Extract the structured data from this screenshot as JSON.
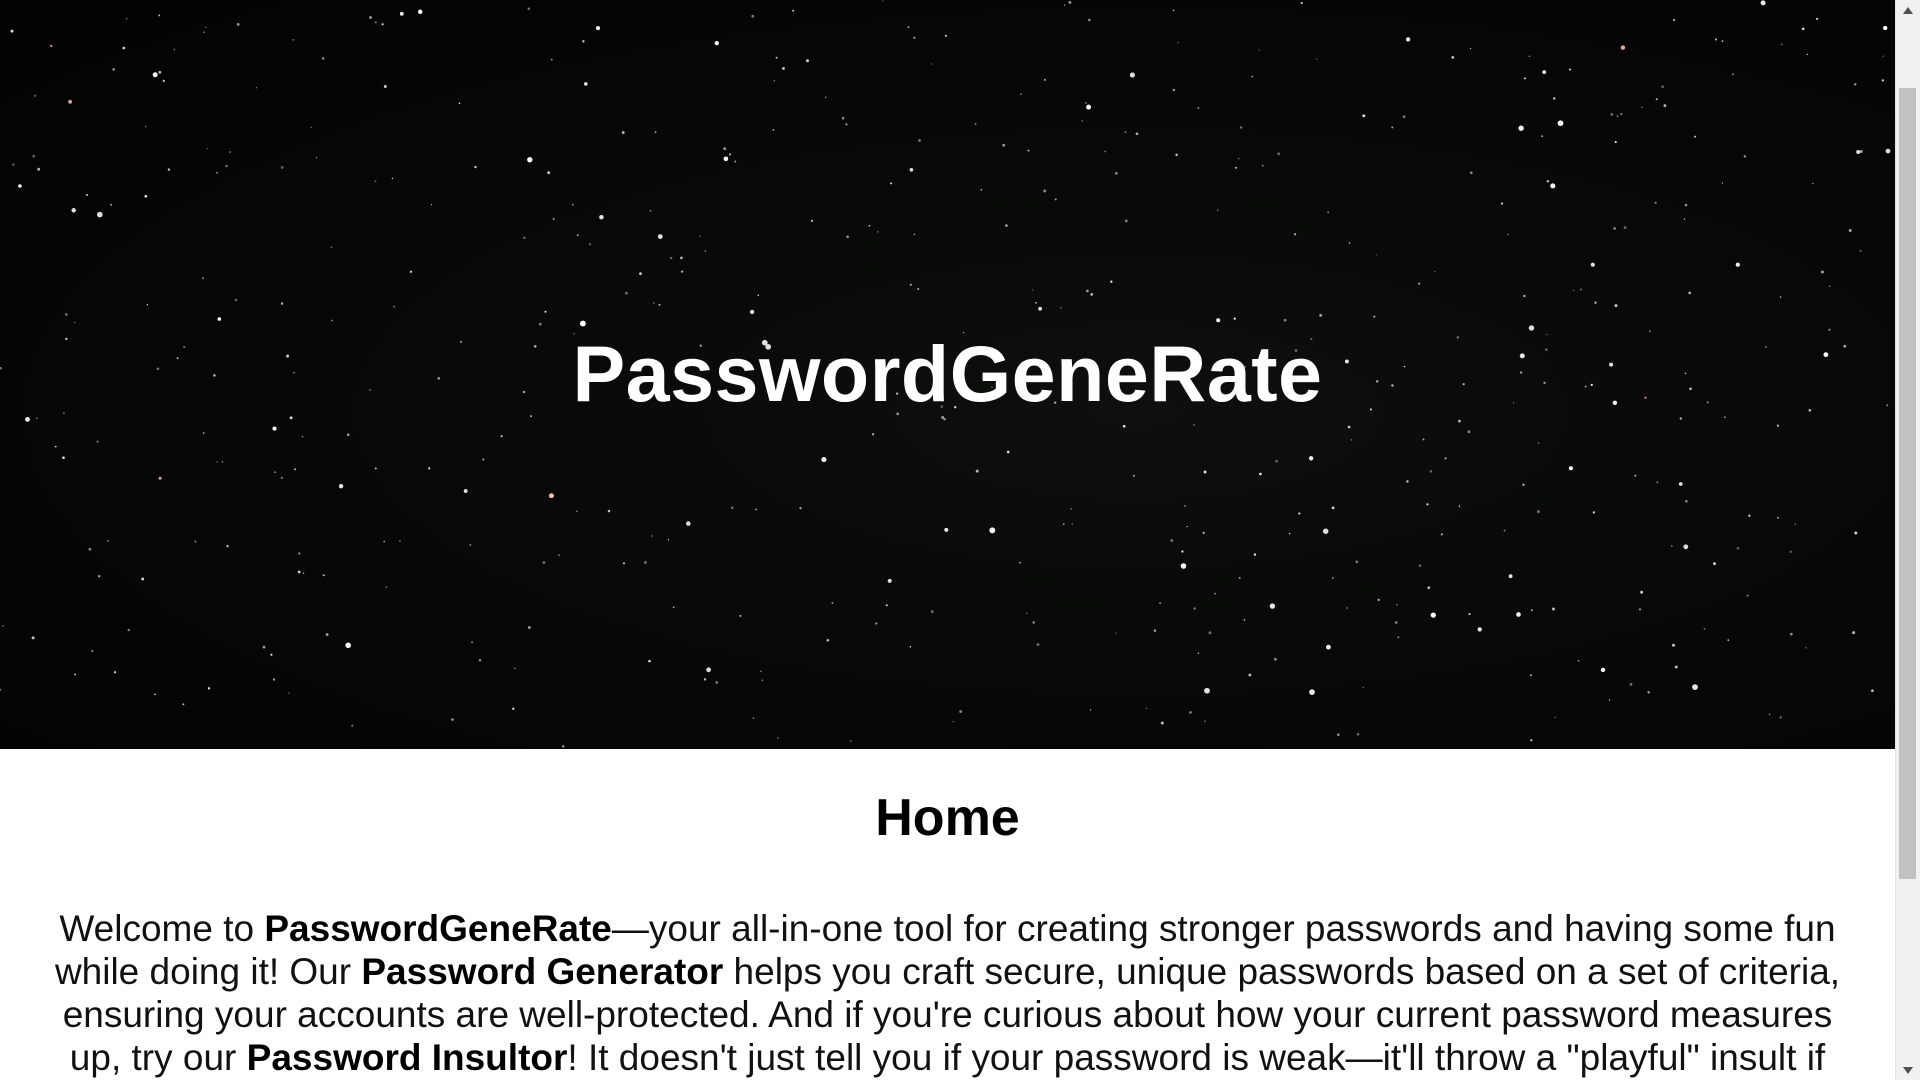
{
  "hero": {
    "title": "PasswordGeneRate"
  },
  "main": {
    "heading": "Home",
    "intro": {
      "p1": "Welcome to ",
      "b1": "PasswordGeneRate",
      "p2": "—your all-in-one tool for creating stronger passwords and having some fun while doing it! Our ",
      "b2": "Password Generator",
      "p3": " helps you craft secure, unique passwords based on a set of criteria, ensuring your accounts are well-protected. And if you're curious about how your current password measures up, try our ",
      "b3": "Password Insultor",
      "p4": "! It doesn't just tell you if your password is weak—it'll throw a \"playful\" insult if"
    }
  },
  "scrollbar": {
    "up_icon": "triangle-up-icon",
    "down_icon": "triangle-down-icon"
  },
  "colors": {
    "hero_bg": "#050505",
    "title": "#ffffff",
    "text": "#111111"
  }
}
